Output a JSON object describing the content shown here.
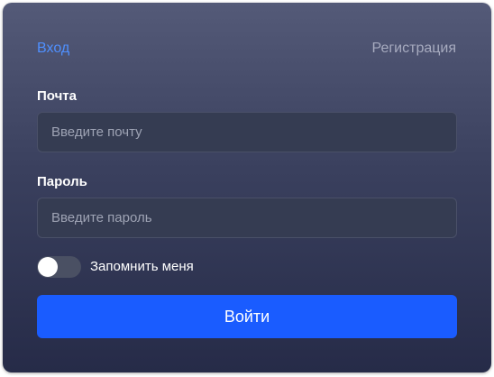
{
  "tabs": {
    "login": "Вход",
    "register": "Регистрация"
  },
  "form": {
    "email_label": "Почта",
    "email_placeholder": "Введите почту",
    "email_value": "",
    "password_label": "Пароль",
    "password_placeholder": "Введите пароль",
    "password_value": "",
    "remember_label": "Запомнить меня",
    "remember_checked": false,
    "submit_label": "Войти"
  },
  "colors": {
    "accent": "#1a5cff",
    "active_tab": "#4f90ff",
    "inactive_tab": "#a7abbf"
  }
}
